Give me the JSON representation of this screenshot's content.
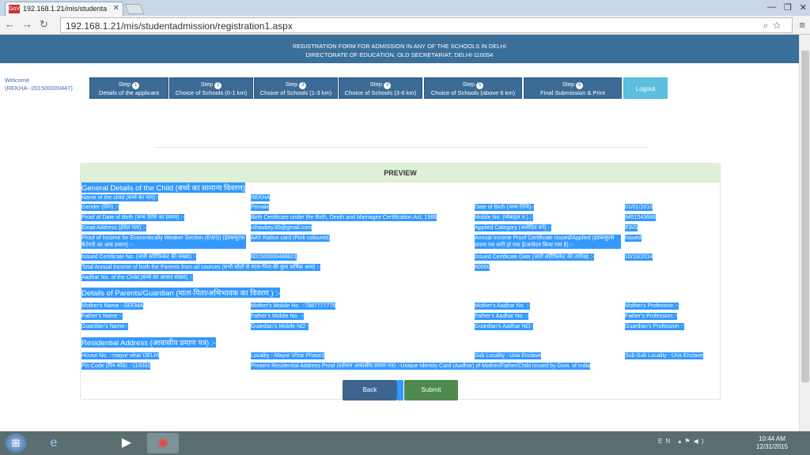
{
  "browser": {
    "tab_title": "192.168.1.21/mis/studenta",
    "tab_favicon": "GoV",
    "url": "192.168.1.21/mis/studentadmission/registration1.aspx"
  },
  "banner": {
    "line1": "REGISTRATION FORM FOR ADMISSION IN ANY OF THE SCHOOLS IN DELHI",
    "line2": "DIRECTORATE OF EDUCATION, OLD SECRETARIAT, DELHI-110054"
  },
  "welcome": {
    "label": "Welcome",
    "user": "(REKHA--201500000447)"
  },
  "steps": [
    {
      "title": "Step",
      "num": "1",
      "label": "Details of the applicant"
    },
    {
      "title": "Step",
      "num": "2",
      "label": "Choice of Schools (0-1 km)"
    },
    {
      "title": "Step",
      "num": "3",
      "label": "Choice of Schools (1-3 km)"
    },
    {
      "title": "Step",
      "num": "4",
      "label": "Choice of Schools (3-6 km)"
    },
    {
      "title": "Step",
      "num": "5",
      "label": "Choice of Schools (above 6 km)"
    },
    {
      "title": "Step",
      "num": "6",
      "label": "Final Submission & Print"
    }
  ],
  "logout_label": "Logout",
  "preview": {
    "title": "PREVIEW",
    "general_heading": "General Details of the Child (बच्चे का सामान्य विवरण)",
    "child_name_label": "Name of the child (बच्चे का नाम):-",
    "child_name": "REKHA",
    "gender_label": "Gender (लिंग) :-",
    "gender": "Female",
    "dob_label": "Date of Birth (जन्म तिथि):-",
    "dob": "01/01/2013",
    "dob_proof_label": "Proof of Date of Birth (जन्म तिथि का प्रमाण) :-",
    "dob_proof": "Birth Certificate under the Birth, Death and Marriages Certification Act, 1986",
    "mobile_label": "Mobile No. (मोबाइल न.) :-",
    "mobile": "9451543686",
    "email_label": "Email Address (ईमेल पता) :-",
    "email": "rchaubey.85@gmail.com",
    "category_label": "Applied Category (आवेदित वर्ग) :-",
    "category": "EWS",
    "income_proof_label": "Proof of Income for Economically Weaker Section (EWS) (इडब्ल्यूएस कैटेगरी का आय प्रमाण) :-",
    "income_proof": "AAY Ration card (Pink coloured)",
    "income_cert_label": "Annual Income Proof Certificate Issued/Applied (इडब्ल्यूएस प्रमाण पत्र जारी हो गया है/आवेदन किया गया है) :-",
    "income_cert": "Issued",
    "cert_no_label": "Issued Certificate No. (जारी सर्टिफिकेट की संख्या) :-",
    "cert_no": "601500000488821",
    "cert_date_label": "Issued Certificate Date (जारी सर्टिफिकेट की तारीख) :-",
    "cert_date": "10/10/2014",
    "total_income_label": "Total Annual Income of both the Parents from all sources (सभी स्रोतों से माता-पिता की कुल वार्षिक आय) :-",
    "total_income": "60000",
    "aadhar_label": "Aadhar No. of the Child (बच्चे का आधार संख्या) :-",
    "parents_heading": "Details of Parents/Guardian (माता-पिता/अभिभावक का विवरण ) :-",
    "mother_name": "Mother's Name :-SEEMA",
    "mother_mobile": "Mother's Mobile No. :-7887777778",
    "mother_aadhar": "Mother's Aadhar No. :-",
    "mother_prof": "Mother's Profession :-",
    "father_name": "Father's Name :-",
    "father_mobile": "Father's Mobile No. :-",
    "father_aadhar": "Father's Aadhar No. :-",
    "father_prof": "Father's Profession :-",
    "guardian_name": "Guardian's Name:-",
    "guardian_mobile": "Guardian's Mobile NO:-",
    "guardian_aadhar": "Guardian's Aadhar NO:-",
    "guardian_prof": "Guardian's Profession :-",
    "address_heading": "Residential Address (आवासीय प्रमाण पत्र) :-",
    "house": "House No. :-mayur vihar DELHI",
    "locality": "Locality :-Mayur Vihar Phase1",
    "sub_locality": "Sub Locality :-Una Enclave",
    "sub_sub_locality": "Sub-Sub Locality :-Una Enclave",
    "pin": "Pin Code (पिन कोड) :-110091",
    "address_proof": "Present Residential Address Proof (वर्तमान आवासीय प्रमाण पत्र) :-Unique Identity Card (Aadhar) of Mother/Father/Child issued by Govt. of India"
  },
  "buttons": {
    "back": "Back",
    "submit": "Submit"
  },
  "taskbar": {
    "lang": "EN",
    "time": "10:44 AM",
    "date": "12/31/2015"
  }
}
